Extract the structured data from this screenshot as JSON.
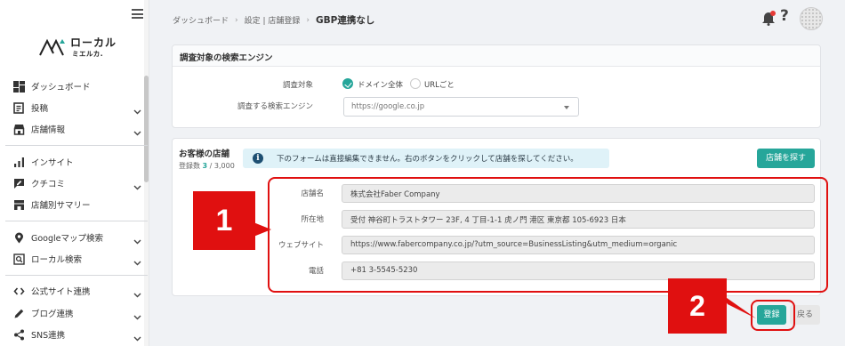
{
  "logo": {
    "line1": "ローカル",
    "line2": "ミエルカ."
  },
  "sidebar": {
    "items": [
      {
        "label": "ダッシュボード",
        "icon": "dashboard-icon",
        "expandable": false
      },
      {
        "label": "投稿",
        "icon": "post-icon",
        "expandable": true
      },
      {
        "label": "店舗情報",
        "icon": "store-icon",
        "expandable": true
      },
      {
        "label": "インサイト",
        "icon": "insight-icon",
        "expandable": false
      },
      {
        "label": "クチコミ",
        "icon": "review-icon",
        "expandable": true
      },
      {
        "label": "店舗別サマリー",
        "icon": "summary-icon",
        "expandable": false
      },
      {
        "label": "Googleマップ検索",
        "icon": "map-pin-icon",
        "expandable": true
      },
      {
        "label": "ローカル検索",
        "icon": "search-box-icon",
        "expandable": true
      },
      {
        "label": "公式サイト連携",
        "icon": "code-icon",
        "expandable": true
      },
      {
        "label": "ブログ連携",
        "icon": "pen-icon",
        "expandable": true
      },
      {
        "label": "SNS連携",
        "icon": "share-icon",
        "expandable": true
      }
    ]
  },
  "breadcrumb": {
    "items": [
      "ダッシュボード",
      "設定 | 店舗登録"
    ],
    "separator": "›",
    "current": "GBP連携なし"
  },
  "topbar": {
    "help": "?"
  },
  "search_panel": {
    "title": "調査対象の検索エンジン",
    "target_label": "調査対象",
    "option_domain": "ドメイン全体",
    "option_url": "URLごと",
    "selected": "ドメイン全体",
    "engine_label": "調査する検索エンジン",
    "engine_value": "https://google.co.jp"
  },
  "store_panel": {
    "title": "お客様の店舗",
    "count_prefix": "登録数",
    "count_value": "3",
    "count_total": "/ 3,000",
    "info_text": "下のフォームは直接編集できません。右のボタンをクリックして店舗を探してください。",
    "find_button": "店舗を探す",
    "fields": [
      {
        "label": "店舗名",
        "value": "株式会社Faber Company"
      },
      {
        "label": "所在地",
        "value": "受付 神谷町トラストタワー 23F, 4 丁目-1-1 虎ノ門 港区 東京都 105-6923 日本"
      },
      {
        "label": "ウェブサイト",
        "value": "https://www.fabercompany.co.jp/?utm_source=BusinessListing&utm_medium=organic"
      },
      {
        "label": "電話",
        "value": "+81 3-5545-5230"
      }
    ]
  },
  "actions": {
    "register": "登録",
    "back": "戻る"
  },
  "annotations": {
    "badge1": "1",
    "badge2": "2"
  },
  "colors": {
    "accent": "#26a69a",
    "highlight": "#e01010",
    "info_bg": "#dff2f8"
  }
}
